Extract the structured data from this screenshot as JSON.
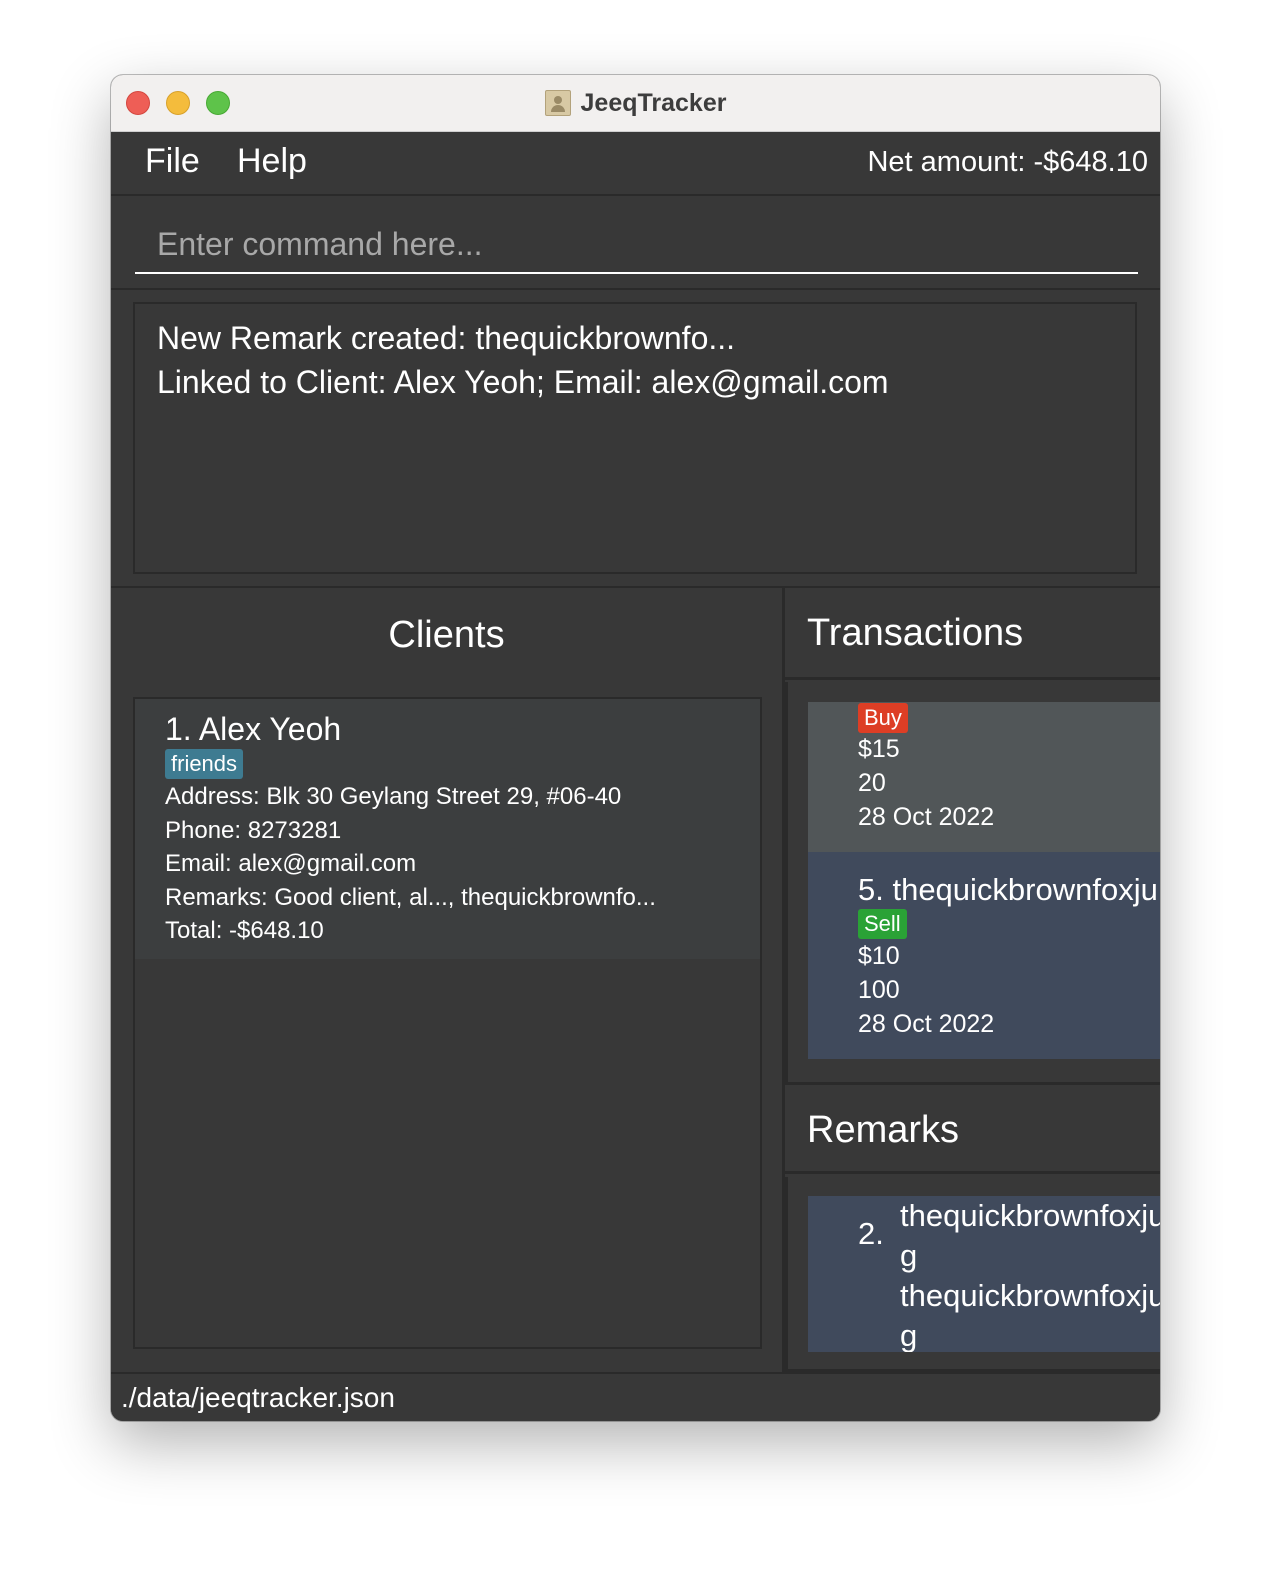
{
  "window": {
    "title": "JeeqTracker"
  },
  "menu": {
    "file": "File",
    "help": "Help"
  },
  "net_amount": "Net amount: -$648.10",
  "command": {
    "placeholder": "Enter command here...",
    "value": ""
  },
  "result": {
    "lines": [
      "New Remark created: thequickbrownfo...",
      "Linked to Client: Alex Yeoh; Email: alex@gmail.com"
    ]
  },
  "clients": {
    "header": "Clients",
    "items": [
      {
        "name": "1.  Alex Yeoh",
        "tag": "friends",
        "address": "Address: Blk 30 Geylang Street 29, #06-40",
        "phone": "Phone: 8273281",
        "email": "Email: alex@gmail.com",
        "remarks": "Remarks: Good client, al..., thequickbrownfo...",
        "total": "Total: -$648.10"
      }
    ]
  },
  "transactions": {
    "header": "Transactions",
    "items": [
      {
        "type": "Buy",
        "price": "$15",
        "quantity": "20",
        "date": "28 Oct 2022"
      },
      {
        "title": "5.  thequickbrownfoxju",
        "type": "Sell",
        "price": "$10",
        "quantity": "100",
        "date": "28 Oct 2022"
      }
    ]
  },
  "remarks": {
    "header": "Remarks",
    "items": [
      {
        "index": "2.",
        "text": "thequickbrownfoxju\ng\nthequickbrownfoxju\ng"
      }
    ]
  },
  "status": {
    "file_path": "./data/jeeqtracker.json"
  },
  "colors": {
    "background": "#383838",
    "buy_badge": "#dd3e25",
    "sell_badge": "#2aa236",
    "tag": "#3e7b91",
    "selected_card": "#404a5c"
  }
}
